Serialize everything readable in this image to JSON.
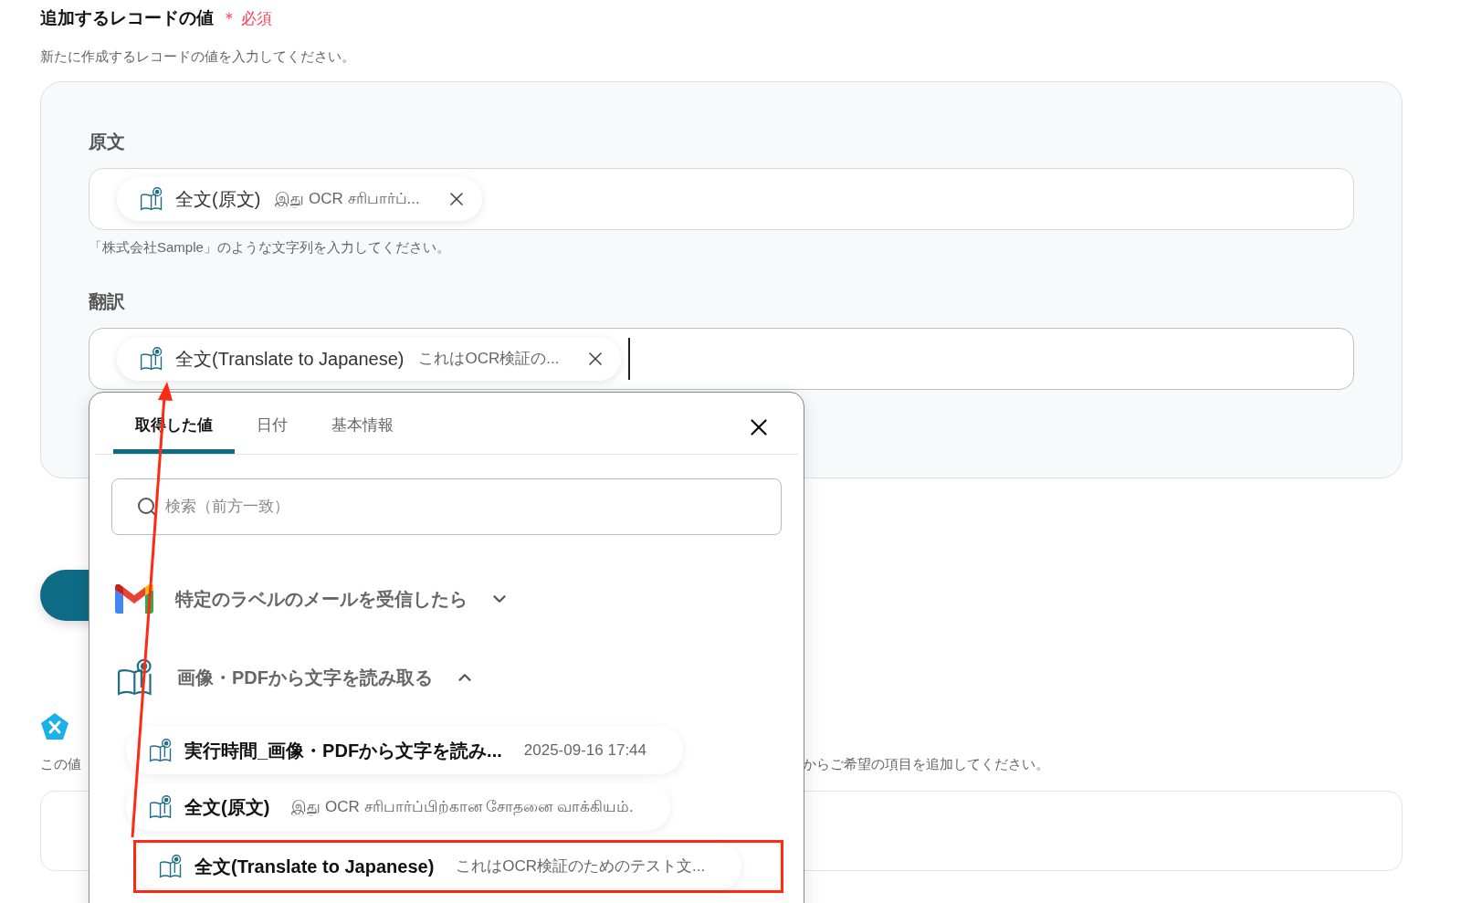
{
  "section": {
    "title": "追加するレコードの値",
    "required_mark": "＊",
    "required": "必須",
    "description": "新たに作成するレコードの値を入力してください。"
  },
  "fields": [
    {
      "label": "原文",
      "chip": {
        "name": "全文(原文)",
        "preview": "இது OCR சரிபார்ப்..."
      },
      "hint": "「株式会社Sample」のような文字列を入力してください。",
      "focused": false
    },
    {
      "label": "翻訳",
      "chip": {
        "name": "全文(Translate to Japanese)",
        "preview": "これはOCR検証の..."
      },
      "focused": true
    }
  ],
  "next_section": {
    "description_start": "この値",
    "description_end": "からご希望の項目を追加してください。"
  },
  "popup": {
    "tabs": [
      {
        "label": "取得した値",
        "selected": true
      },
      {
        "label": "日付",
        "selected": false
      },
      {
        "label": "基本情報",
        "selected": false
      }
    ],
    "search": {
      "placeholder": "検索（前方一致）"
    },
    "groups": [
      {
        "kind": "gmail",
        "title": "特定のラベルのメールを受信したら",
        "expanded": false
      },
      {
        "kind": "ocr",
        "title": "画像・PDFから文字を読み取る",
        "expanded": true,
        "items": [
          {
            "name": "実行時間_画像・PDFから文字を読み...",
            "value": "2025-09-16 17:44",
            "highlighted": false
          },
          {
            "name": "全文(原文)",
            "value": "இது OCR சரிபார்ப்பிற்கான சோதனை வாக்கியம்.",
            "highlighted": false
          },
          {
            "name": "全文(Translate to Japanese)",
            "value": "これはOCR検証のためのテスト文...",
            "highlighted": true
          }
        ]
      }
    ]
  }
}
